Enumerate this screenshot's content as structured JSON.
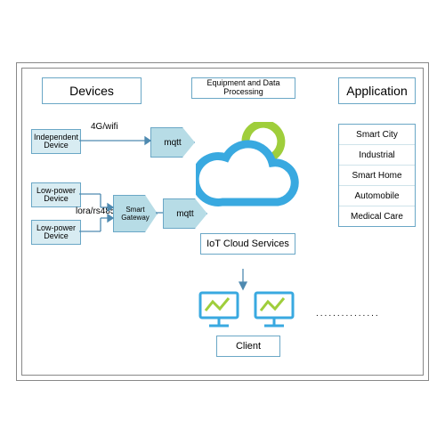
{
  "columns": {
    "devices": "Devices",
    "processing": "Equipment and Data Processing",
    "application": "Application"
  },
  "devices": {
    "independent": "Independent\nDevice",
    "low1": "Low-power\nDevice",
    "low2": "Low-power\nDevice",
    "gateway": "Smart\nGateway",
    "link_top": "4G/wifi",
    "link_bottom": "lora/rs485"
  },
  "protocol": {
    "mqtt1": "mqtt",
    "mqtt2": "mqtt"
  },
  "cloud": "IoT Cloud Services",
  "client": "Client",
  "applications": [
    "Smart City",
    "Industrial",
    "Smart Home",
    "Automobile",
    "Medical Care"
  ],
  "ellipsis": "..............."
}
